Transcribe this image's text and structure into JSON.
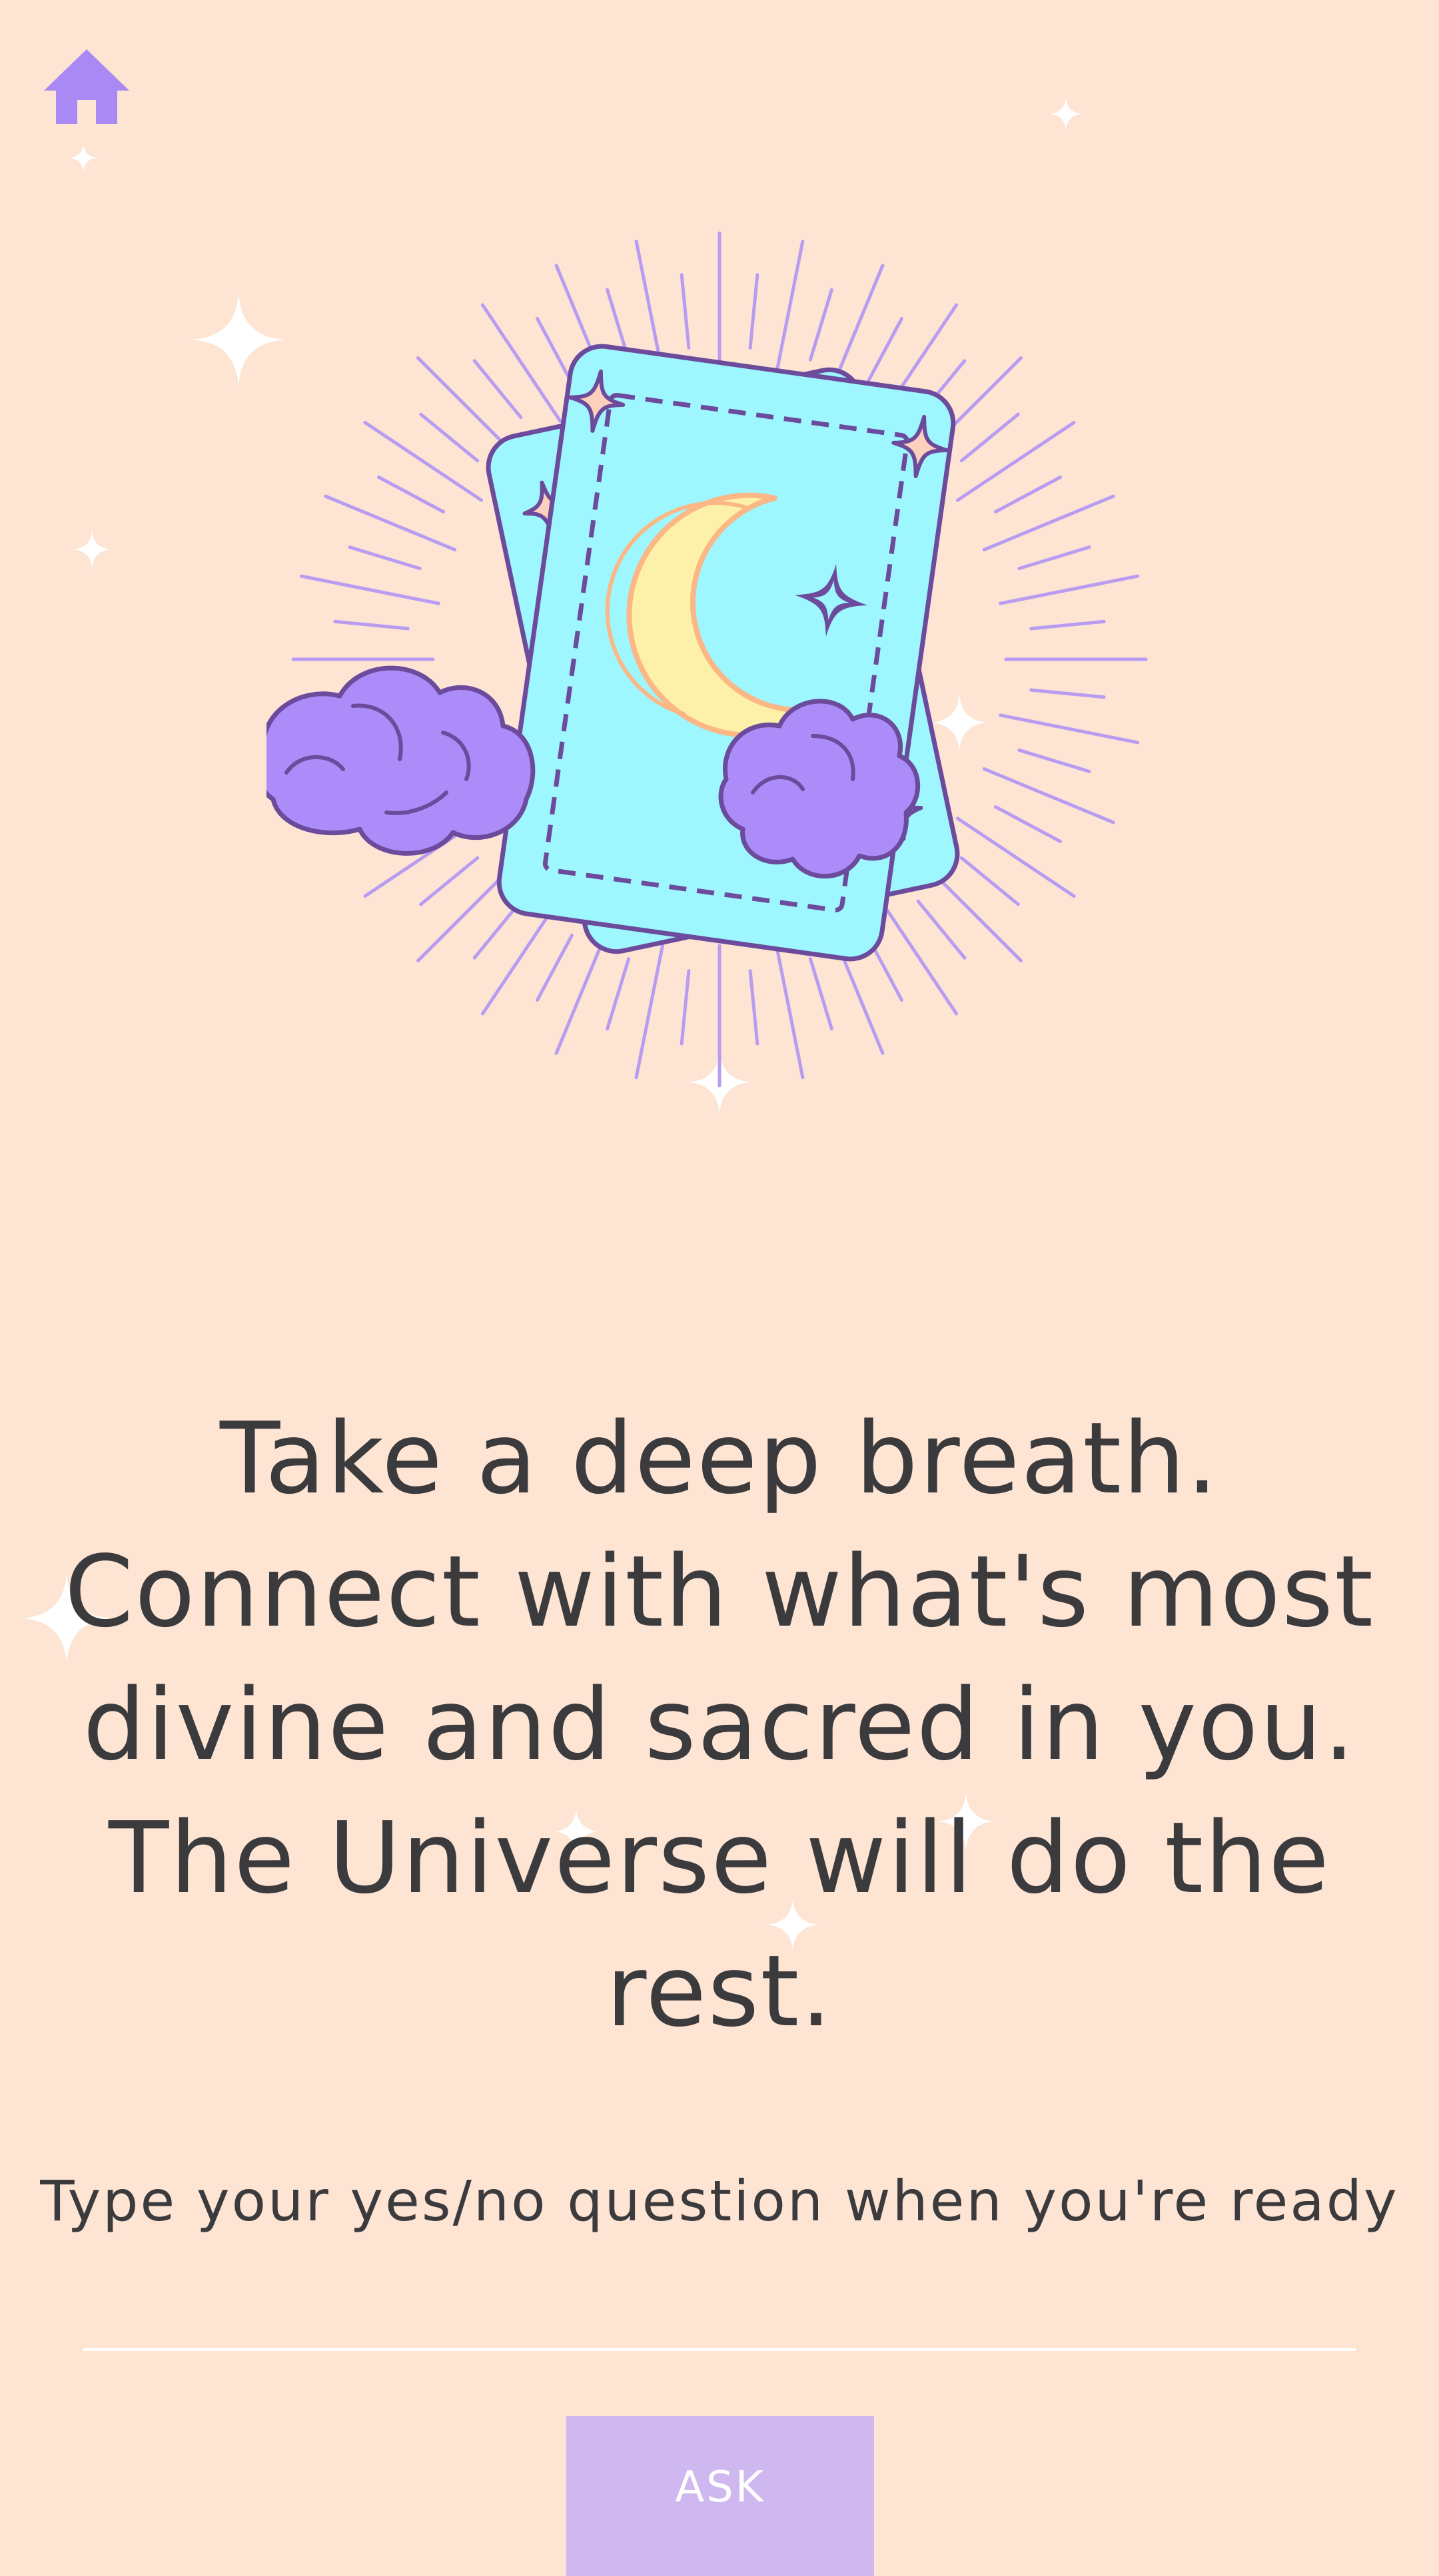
{
  "colors": {
    "background": "#fde4d3",
    "accent": "#a98af5",
    "card": "#9ef6fe",
    "cloud": "#ab8cf8",
    "moon": "#fdf0a8",
    "text": "#3b3a3d",
    "button": "#cfb8ef"
  },
  "nav": {
    "home_icon": "home-icon"
  },
  "hero": {
    "illustration": "tarot-cards-moon-illustration"
  },
  "main": {
    "message": "Take a deep breath. Connect with what's most divine and sacred in you. The Universe will do the rest."
  },
  "question": {
    "prompt": "Type your yes/no question when you're ready",
    "value": "",
    "placeholder": ""
  },
  "ask_button": {
    "label": "ASK"
  }
}
